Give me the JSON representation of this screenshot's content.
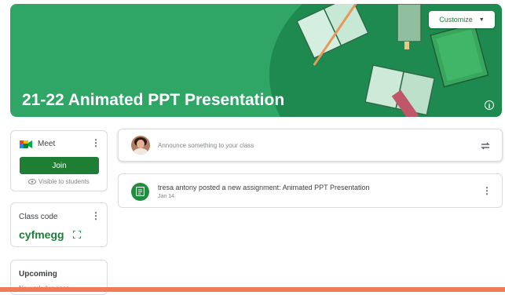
{
  "banner": {
    "title": "21-22 Animated PPT Presentation",
    "customize_label": "Customize",
    "accent": "#2fa566"
  },
  "meet": {
    "label": "Meet",
    "join_label": "Join",
    "visibility": "Visible to students"
  },
  "class_code": {
    "label": "Class code",
    "code": "cyfmegg"
  },
  "upcoming": {
    "label": "Upcoming",
    "empty": "No work due soon"
  },
  "stream": {
    "announce_placeholder": "Announce something to your class",
    "post_title": "tresa antony posted a new assignment: Animated PPT Presentation",
    "post_date": "Jan 14"
  }
}
